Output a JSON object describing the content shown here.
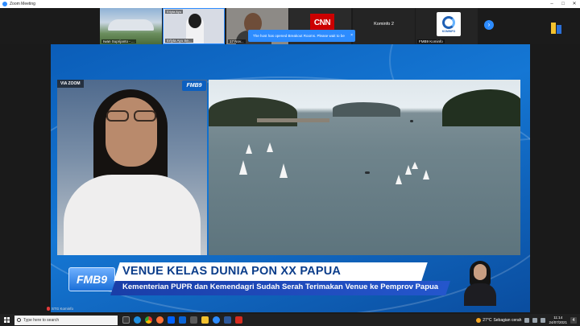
{
  "window": {
    "title": "Zoom Meeting",
    "controls": [
      "–",
      "□",
      "✕"
    ]
  },
  "gallery": {
    "participants": [
      {
        "name": "Iwan Suprijanto - ...",
        "type": "video-stadium"
      },
      {
        "name": "Erlyta Ayu Se...",
        "type": "video-person",
        "top_label": "Erlyta Ayu"
      },
      {
        "name": "17 Nov...",
        "type": "video-person"
      },
      {
        "name": "",
        "type": "logo",
        "logo_text": "CNN"
      },
      {
        "name": "",
        "type": "name-only",
        "display_name": "Kominfo 2"
      },
      {
        "name": "FMB9 Kominfo",
        "type": "logo",
        "logo_text": "KOMINFO"
      }
    ],
    "next_page_icon": "chevron-right-icon"
  },
  "toast": {
    "message": "The host has opened Breakout Rooms. Please wait to be assigned.",
    "close": "×"
  },
  "broadcast": {
    "via_label": "VIA ZOOM",
    "brand_small": "FMB9",
    "brand_big": "FMB9",
    "headline": "VENUE KELAS DUNIA PON XX PAPUA",
    "subheadline": "Kementerian PUPR dan Kemendagri Sudah Serah Terimakan Venue ke Pemprov Papua"
  },
  "active_speaker": {
    "name": "STG Kominfo"
  },
  "taskbar": {
    "search_placeholder": "Type here to search",
    "pinned_icons": [
      "task-view-icon",
      "edge-icon",
      "chrome-icon",
      "firefox-icon",
      "dropbox-icon",
      "mail-icon",
      "store-icon",
      "explorer-icon",
      "zoom-icon",
      "word-icon",
      "acrobat-icon"
    ],
    "weather_temp": "27°C",
    "weather_text": "Sebagian cerah",
    "time": "11:14",
    "date": "24/07/2021",
    "notification_count": "4"
  },
  "colors": {
    "zoom_blue": "#2d8cff",
    "broadcast_blue": "#1577d4",
    "headline_text": "#0b3d8a",
    "subbar_blue": "#2456cc"
  }
}
